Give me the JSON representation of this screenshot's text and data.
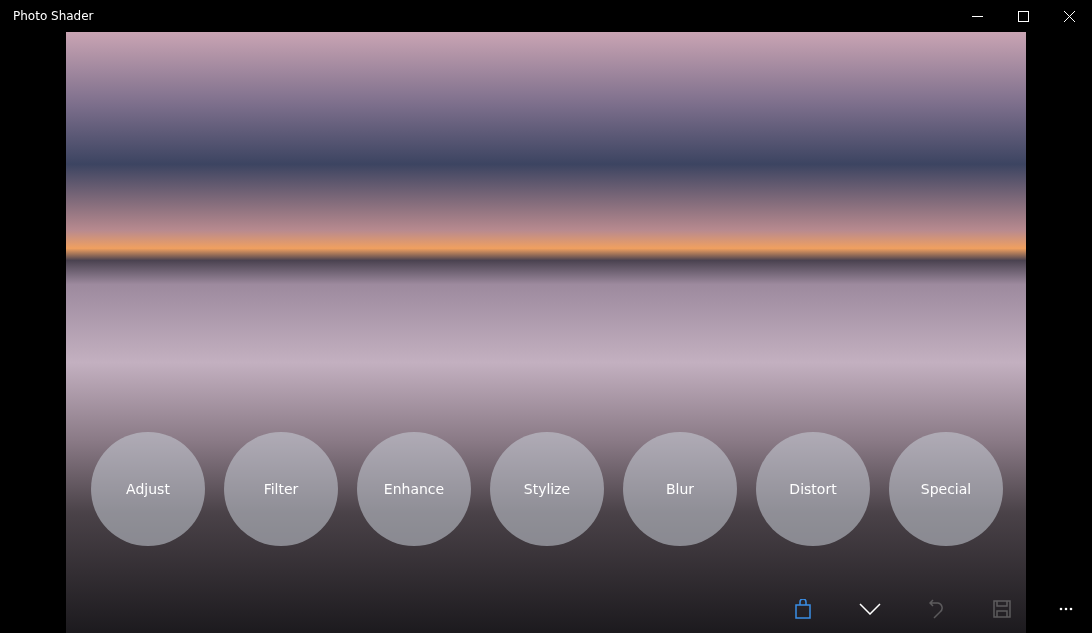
{
  "window": {
    "title": "Photo Shader"
  },
  "categories": [
    {
      "label": "Adjust"
    },
    {
      "label": "Filter"
    },
    {
      "label": "Enhance"
    },
    {
      "label": "Stylize"
    },
    {
      "label": "Blur"
    },
    {
      "label": "Distort"
    },
    {
      "label": "Special"
    }
  ],
  "toolbar": [
    {
      "kind": "store",
      "disabled": false
    },
    {
      "kind": "collapse",
      "disabled": false
    },
    {
      "kind": "undo",
      "disabled": true
    },
    {
      "kind": "save",
      "disabled": true
    },
    {
      "kind": "more",
      "disabled": false
    }
  ]
}
